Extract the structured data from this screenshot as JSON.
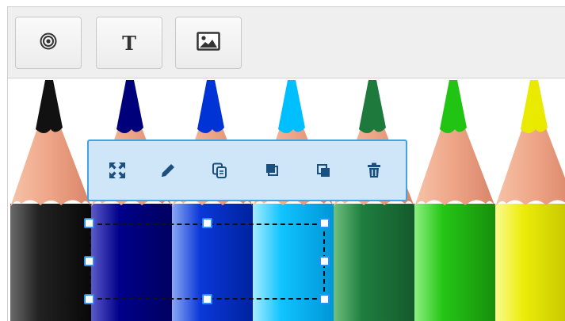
{
  "toolbar": {
    "buttons": [
      {
        "name": "shape-tool-button",
        "icon": "concentric-circles-icon"
      },
      {
        "name": "text-tool-button",
        "icon": "text-icon",
        "glyph": "T"
      },
      {
        "name": "image-tool-button",
        "icon": "image-icon"
      }
    ]
  },
  "canvas": {
    "image": "colored-pencils",
    "pencil_colors": [
      "#111111",
      "#00007a",
      "#0033d6",
      "#00bfff",
      "#1e7a3c",
      "#22c414",
      "#eaea00"
    ]
  },
  "popup": {
    "background": "#cfe6f8",
    "border_color": "#43a2e4",
    "icon_color": "#1a4f80",
    "actions": [
      {
        "name": "resize-button",
        "icon": "expand-arrows-icon"
      },
      {
        "name": "edit-button",
        "icon": "pencil-icon"
      },
      {
        "name": "duplicate-button",
        "icon": "copy-icon"
      },
      {
        "name": "bring-to-front-button",
        "icon": "bring-to-front-icon"
      },
      {
        "name": "send-to-back-button",
        "icon": "send-to-back-icon"
      },
      {
        "name": "delete-button",
        "icon": "trash-icon"
      }
    ]
  },
  "selection": {
    "handle_color": "#2f8ff0"
  }
}
